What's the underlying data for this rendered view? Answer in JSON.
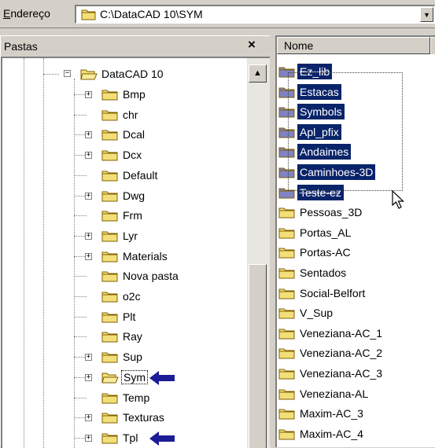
{
  "address": {
    "label_prefix": "E",
    "label_rest": "ndereço",
    "path": "C:\\DataCAD 10\\SYM"
  },
  "folders_pane": {
    "title": "Pastas",
    "close": "×",
    "root": "DataCAD 10",
    "items": [
      {
        "label": "Bmp",
        "expandable": true
      },
      {
        "label": "chr",
        "expandable": false
      },
      {
        "label": "Dcal",
        "expandable": true
      },
      {
        "label": "Dcx",
        "expandable": true
      },
      {
        "label": "Default",
        "expandable": false
      },
      {
        "label": "Dwg",
        "expandable": true
      },
      {
        "label": "Frm",
        "expandable": false
      },
      {
        "label": "Lyr",
        "expandable": true
      },
      {
        "label": "Materials",
        "expandable": true
      },
      {
        "label": "Nova pasta",
        "expandable": false
      },
      {
        "label": "o2c",
        "expandable": false
      },
      {
        "label": "Plt",
        "expandable": false
      },
      {
        "label": "Ray",
        "expandable": false
      },
      {
        "label": "Sup",
        "expandable": true
      },
      {
        "label": "Sym",
        "expandable": true,
        "selected": true,
        "open": true,
        "arrow": true
      },
      {
        "label": "Temp",
        "expandable": false
      },
      {
        "label": "Texturas",
        "expandable": true
      },
      {
        "label": "Tpl",
        "expandable": true,
        "arrow": true
      }
    ]
  },
  "files_pane": {
    "column_name": "Nome",
    "items": [
      {
        "label": "Ez_lib",
        "selected": true,
        "strike": true
      },
      {
        "label": "Estacas",
        "selected": true
      },
      {
        "label": "Symbols",
        "selected": true
      },
      {
        "label": "Apl_pfix",
        "selected": true
      },
      {
        "label": "Andaimes",
        "selected": true
      },
      {
        "label": "Caminhoes-3D",
        "selected": true
      },
      {
        "label": "Teste-ez",
        "selected": true,
        "strike": true
      },
      {
        "label": "Pessoas_3D"
      },
      {
        "label": "Portas_AL"
      },
      {
        "label": "Portas-AC"
      },
      {
        "label": "Sentados"
      },
      {
        "label": "Social-Belfort"
      },
      {
        "label": "V_Sup"
      },
      {
        "label": "Veneziana-AC_1"
      },
      {
        "label": "Veneziana-AC_2"
      },
      {
        "label": "Veneziana-AC_3"
      },
      {
        "label": "Veneziana-AL"
      },
      {
        "label": "Maxim-AC_3"
      },
      {
        "label": "Maxim-AC_4"
      }
    ]
  },
  "colors": {
    "folder": "#f3df7a",
    "folder_tab": "#f9ec9c",
    "selection": "#0a246a",
    "arrow": "#1c1c96",
    "chrome": "#d4d0c8"
  },
  "icons": [
    "folder-icon",
    "open-folder-icon",
    "blue-arrow-icon",
    "close-icon",
    "mouse-pointer-icon",
    "scroll-up-icon",
    "dropdown-arrow-icon"
  ]
}
